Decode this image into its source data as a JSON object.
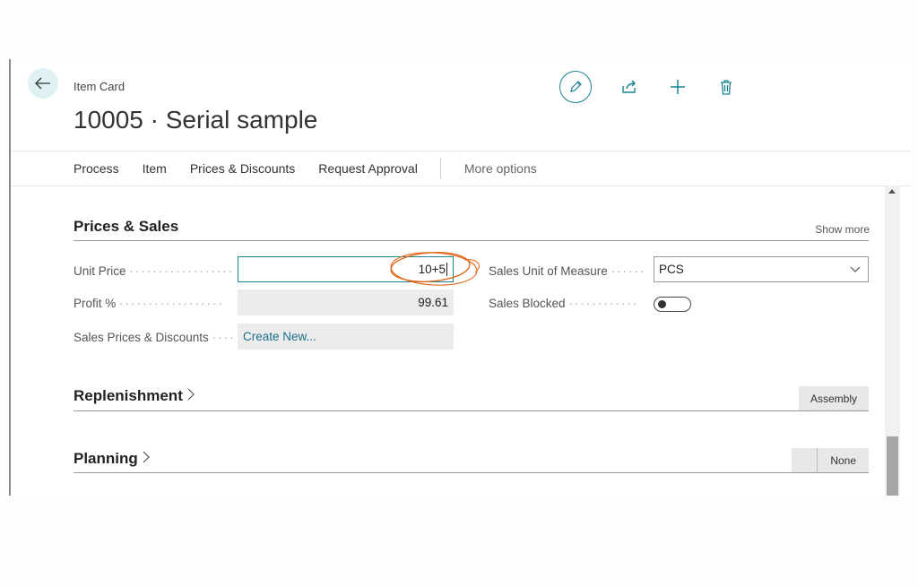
{
  "header": {
    "caption": "Item Card",
    "title": "10005 · Serial sample"
  },
  "icons": {
    "back": "arrow-left-icon",
    "edit": "pencil-icon",
    "share": "share-icon",
    "add": "plus-icon",
    "delete": "trash-icon"
  },
  "toolbar": {
    "items": [
      "Process",
      "Item",
      "Prices & Discounts",
      "Request Approval"
    ],
    "more_label": "More options"
  },
  "prices_sales": {
    "title": "Prices & Sales",
    "show_more": "Show more",
    "unit_price_label": "Unit Price",
    "unit_price_value": "10+5",
    "profit_label": "Profit %",
    "profit_value": "99.61",
    "sales_prices_label": "Sales Prices & Discounts",
    "sales_prices_value": "Create New...",
    "sales_uom_label": "Sales Unit of Measure",
    "sales_uom_value": "PCS",
    "sales_blocked_label": "Sales Blocked",
    "sales_blocked_on": false
  },
  "replenishment": {
    "title": "Replenishment",
    "value": "Assembly"
  },
  "planning": {
    "title": "Planning",
    "value": "None"
  },
  "colors": {
    "accent": "#1b8392",
    "annotation": "#e06a1e"
  }
}
